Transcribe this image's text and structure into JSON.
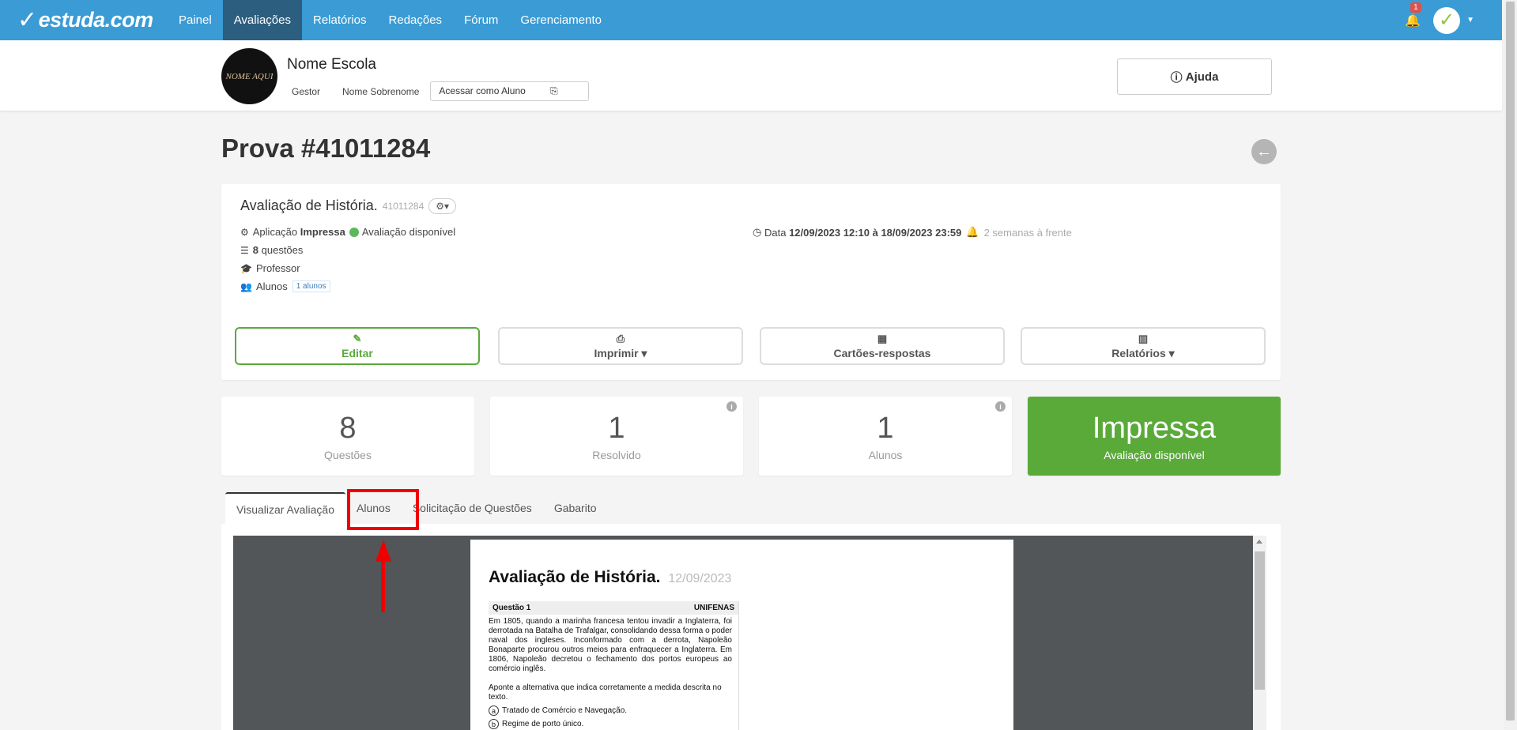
{
  "nav": {
    "logo_text": "estuda.com",
    "items": [
      {
        "label": "Painel"
      },
      {
        "label": "Avaliações"
      },
      {
        "label": "Relatórios"
      },
      {
        "label": "Redações"
      },
      {
        "label": "Fórum"
      },
      {
        "label": "Gerenciamento"
      }
    ],
    "active_index": 1,
    "notification_count": "1"
  },
  "school": {
    "logo_text": "NOME AQUI",
    "name": "Nome Escola",
    "role": "Gestor",
    "user": "Nome Sobrenome",
    "access_as_student": "Acessar como Aluno",
    "help": "Ajuda"
  },
  "page": {
    "title": "Prova #41011284"
  },
  "assessment": {
    "title": "Avaliação de História.",
    "code": "41011284",
    "application_label": "Aplicação",
    "application_value": "Impressa",
    "status": "Avaliação disponível",
    "questions_count": "8",
    "questions_label": "questões",
    "teacher_label": "Professor",
    "students_label": "Alunos",
    "students_tag": "1 alunos",
    "date_label": "Data",
    "date_value": "12/09/2023 12:10 à 18/09/2023 23:59",
    "date_relative": "2 semanas à frente"
  },
  "actions": {
    "edit": "Editar",
    "print": "Imprimir",
    "answer_cards": "Cartões-respostas",
    "reports": "Relatórios"
  },
  "stats": [
    {
      "value": "8",
      "label": "Questões"
    },
    {
      "value": "1",
      "label": "Resolvido"
    },
    {
      "value": "1",
      "label": "Alunos"
    },
    {
      "value": "Impressa",
      "label": "Avaliação disponível"
    }
  ],
  "tabs": [
    {
      "label": "Visualizar Avaliação"
    },
    {
      "label": "Alunos"
    },
    {
      "label": "Solicitação de Questões"
    },
    {
      "label": "Gabarito"
    }
  ],
  "preview": {
    "title": "Avaliação de História.",
    "date": "12/09/2023",
    "question_label": "Questão 1",
    "question_source": "UNIFENAS",
    "question_text": "Em 1805, quando a marinha francesa tentou invadir a Inglaterra, foi derrotada na Batalha de Trafalgar, consolidando dessa forma o poder naval dos ingleses. Inconformado com a derrota, Napoleão Bonaparte procurou outros meios para enfraquecer a Inglaterra. Em 1806, Napoleão decretou o fechamento dos portos europeus ao comércio inglês.",
    "prompt": "Aponte a alternativa que indica corretamente a medida descrita no texto.",
    "options": [
      {
        "letter": "a",
        "text": "Tratado de Comércio e Navegação."
      },
      {
        "letter": "b",
        "text": "Regime de porto único."
      }
    ]
  },
  "colors": {
    "nav_bg": "#3a9bd5",
    "nav_active": "#2c5e7f",
    "green": "#5aaa3a",
    "highlight": "#e00000"
  }
}
